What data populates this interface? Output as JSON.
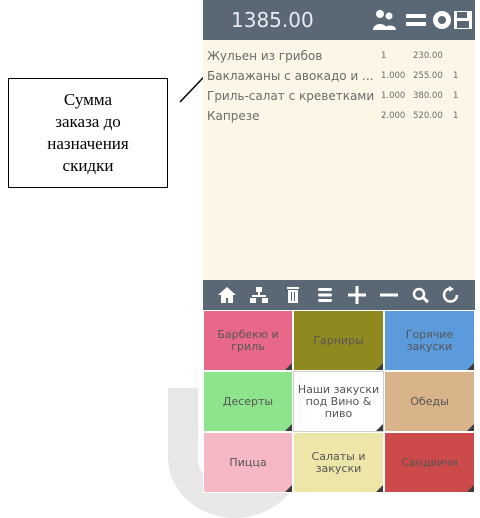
{
  "callout": {
    "line1": "Сумма",
    "line2": "заказа до",
    "line3": "назначения",
    "line4": "скидки"
  },
  "header": {
    "total": "1385.00",
    "icons": [
      "users-icon",
      "menu-icon",
      "settings-icon",
      "save-icon"
    ]
  },
  "order": {
    "items": [
      {
        "name": "Жульен из грибов",
        "qty": "1",
        "price": "230.00",
        "mod": ""
      },
      {
        "name": "Баклажаны с авокадо и ...",
        "qty": "1.000",
        "price": "255.00",
        "mod": "1"
      },
      {
        "name": "Гриль-салат с креветками",
        "qty": "1.000",
        "price": "380.00",
        "mod": "1"
      },
      {
        "name": "Капрезе",
        "qty": "2.000",
        "price": "520.00",
        "mod": "1"
      }
    ]
  },
  "actions": {
    "icons": [
      "home-icon",
      "hierarchy-icon",
      "delete-icon",
      "list-icon",
      "plus-icon",
      "minus-icon",
      "search-icon",
      "refresh-icon"
    ]
  },
  "categories": [
    {
      "label": "Барбекю и гриль",
      "color": "#e8688a"
    },
    {
      "label": "Гарниры",
      "color": "#8f8a1f"
    },
    {
      "label": "Горячие закуски",
      "color": "#5b9bdc"
    },
    {
      "label": "Десерты",
      "color": "#8ee48c"
    },
    {
      "label": "Наши закуски под Вино & пиво",
      "color": "#ffffff"
    },
    {
      "label": "Обеды",
      "color": "#d9b38a"
    },
    {
      "label": "Пицца",
      "color": "#f7b8c6"
    },
    {
      "label": "Салаты и закуски",
      "color": "#ede6a8"
    },
    {
      "label": "Сандвичи",
      "color": "#cc4a4a"
    }
  ]
}
